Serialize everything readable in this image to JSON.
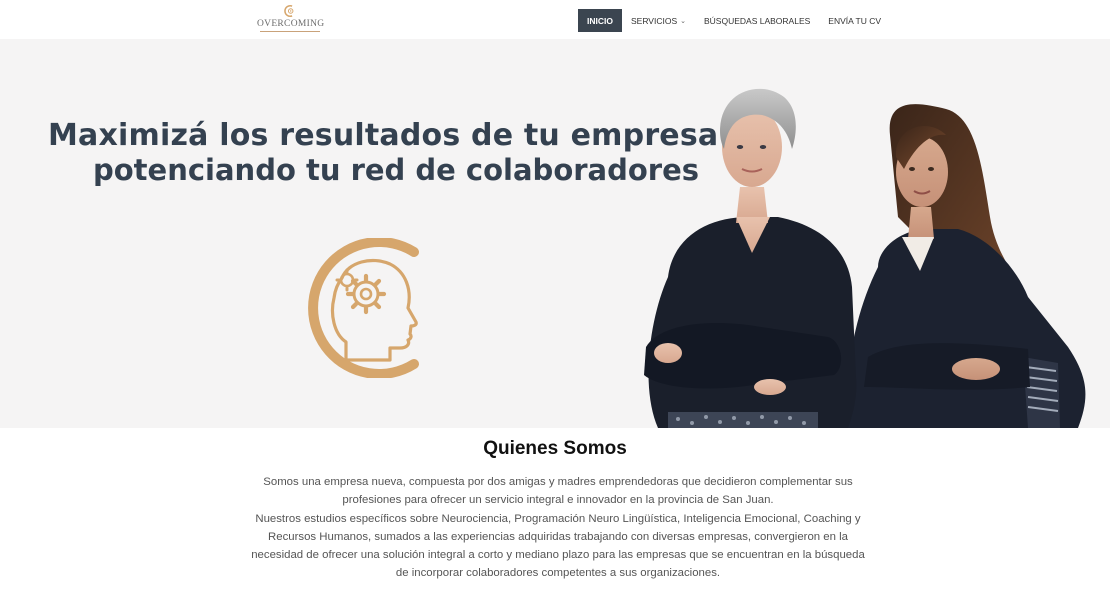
{
  "header": {
    "logo_text": "OVERCOMING",
    "nav": [
      {
        "label": "INICIO",
        "active": true
      },
      {
        "label": "SERVICIOS",
        "has_dropdown": true,
        "dropdown_icon": "chevron-down-icon"
      },
      {
        "label": "BÚSQUEDAS LABORALES"
      },
      {
        "label": "ENVÍA TU CV"
      }
    ]
  },
  "hero": {
    "title": "Maximizá los resultados de tu empresa",
    "subtitle": "potenciando tu red de colaboradores",
    "icon": "head-gear-icon",
    "image": "two-women-crossed-arms-photo"
  },
  "about": {
    "title": "Quienes Somos",
    "paragraph_1": "Somos una empresa nueva, compuesta por dos amigas y madres emprendedoras que decidieron complementar sus profesiones para ofrecer un servicio integral e innovador en la provincia de San Juan.",
    "paragraph_2": "Nuestros estudios específicos sobre Neurociencia, Programación Neuro Lingüística, Inteligencia Emocional, Coaching y Recursos Humanos, sumados a las experiencias adquiridas trabajando con diversas empresas, convergieron en la necesidad de ofrecer una solución integral a corto y mediano plazo para las empresas que se encuentran en la búsqueda de incorporar colaboradores competentes a sus organizaciones."
  },
  "colors": {
    "brand_gold": "#d6a66c",
    "nav_active_bg": "#3b4550",
    "headline": "#344150",
    "hero_bg": "#f5f4f4"
  }
}
